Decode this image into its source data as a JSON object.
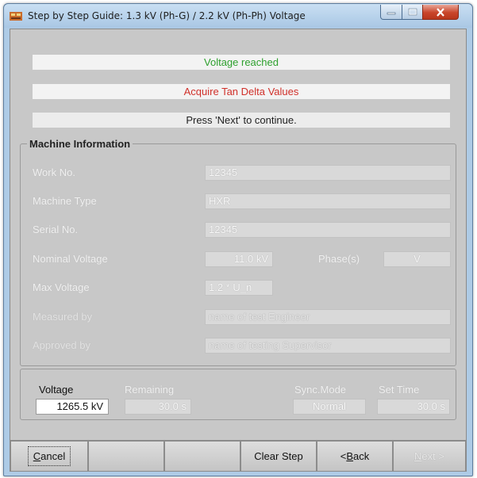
{
  "window": {
    "title": "Step by Step Guide: 1.3 kV (Ph-G) / 2.2 kV (Ph-Ph) Voltage",
    "controls": [
      "minimize-icon",
      "maximize-icon",
      "close-icon"
    ]
  },
  "banners": {
    "status": "Voltage reached",
    "action": "Acquire Tan Delta Values",
    "instruction": "Press 'Next' to continue."
  },
  "machine_info": {
    "title": "Machine Information",
    "work_no": {
      "label": "Work No.",
      "value": "12345"
    },
    "machine_type": {
      "label": "Machine Type",
      "value": "HXR"
    },
    "serial_no": {
      "label": "Serial No.",
      "value": "12345"
    },
    "nominal_voltage": {
      "label": "Nominal Voltage",
      "value": "11.0 kV"
    },
    "phase": {
      "label": "Phase(s)",
      "value": "V"
    },
    "max_voltage": {
      "label": "Max Voltage",
      "value": "1.2 * U_n"
    },
    "measured_by": {
      "label": "Measured by",
      "value": "name of test Engineer"
    },
    "approved_by": {
      "label": "Approved by",
      "value": "name of testing Supervisor"
    }
  },
  "status": {
    "voltage_label": "Voltage",
    "voltage_value": "1265.5 kV",
    "remaining_label": "Remaining",
    "remaining_value": "30.0  s",
    "sync_mode_label": "Sync.Mode",
    "sync_mode_value": "Normal",
    "set_time_label": "Set Time",
    "set_time_value": "30.0  s"
  },
  "buttons": {
    "cancel": {
      "pre": "",
      "mnemonic": "C",
      "post": "ancel"
    },
    "clear_step": "Clear Step",
    "back": {
      "pre": "< ",
      "mnemonic": "B",
      "post": "ack"
    },
    "next": {
      "pre": "",
      "mnemonic": "N",
      "post": "ext >"
    }
  },
  "colors": {
    "status_green": "#2ea02e",
    "action_red": "#d0302a",
    "panel_gray": "#c8c8c8",
    "frame_blue": "#aecbe6"
  }
}
